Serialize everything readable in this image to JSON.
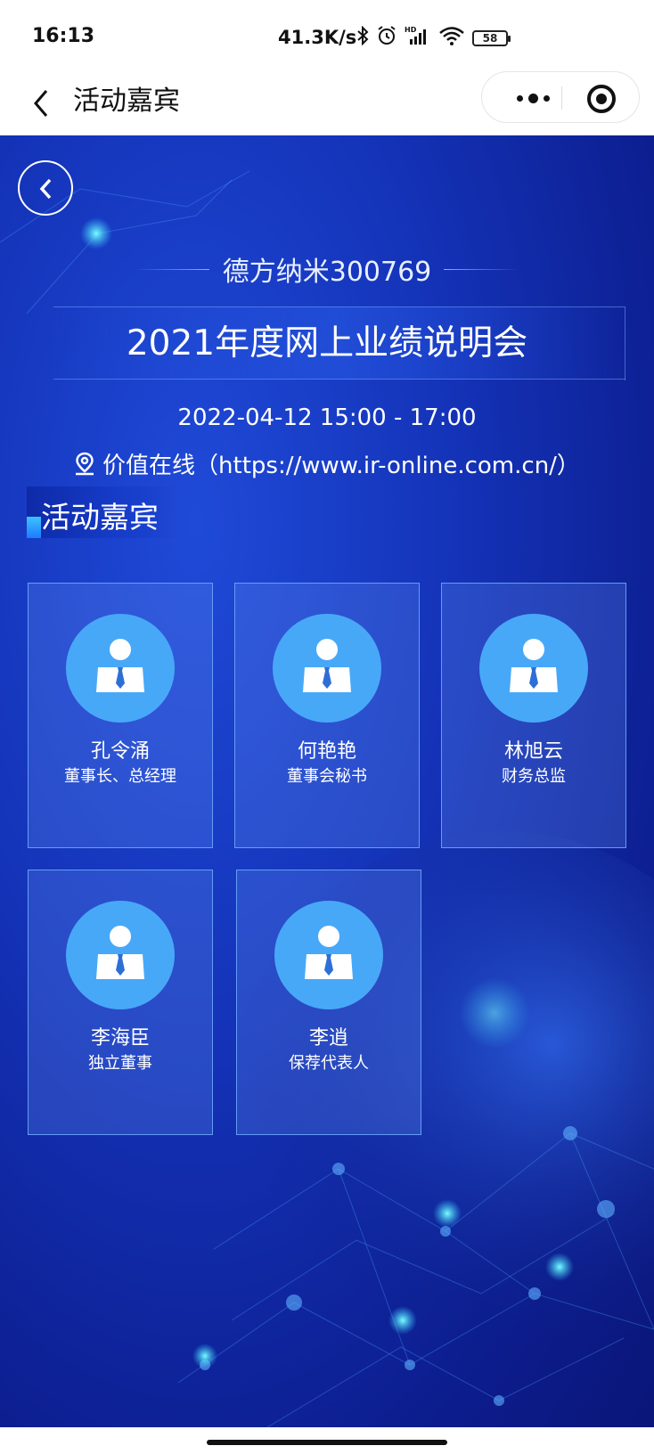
{
  "status_bar": {
    "time": "16:13",
    "network_speed": "41.3K/s",
    "battery": "58",
    "icons": [
      "bluetooth-icon",
      "alarm-icon",
      "hd-signal-icon",
      "wifi-icon"
    ]
  },
  "nav_bar": {
    "title": "活动嘉宾",
    "back_icon": "chevron-left-icon",
    "more_icon": "more-dots-icon",
    "close_icon": "target-close-icon"
  },
  "event": {
    "company": "德方纳米300769",
    "title": "2021年度网上业绩说明会",
    "time": "2022-04-12 15:00 - 17:00",
    "location": "价值在线（https://www.ir-online.com.cn/）"
  },
  "section": {
    "title": "活动嘉宾"
  },
  "guests": [
    {
      "name": "孔令涌",
      "role": "董事长、总经理"
    },
    {
      "name": "何艳艳",
      "role": "董事会秘书"
    },
    {
      "name": "林旭云",
      "role": "财务总监"
    },
    {
      "name": "李海臣",
      "role": "独立董事"
    },
    {
      "name": "李逍",
      "role": "保荐代表人"
    }
  ],
  "colors": {
    "background_blue": "#1433b8",
    "avatar_blue": "#48a8f8",
    "card_border": "#6eaaff",
    "accent_cyan": "#3ec3ff"
  }
}
